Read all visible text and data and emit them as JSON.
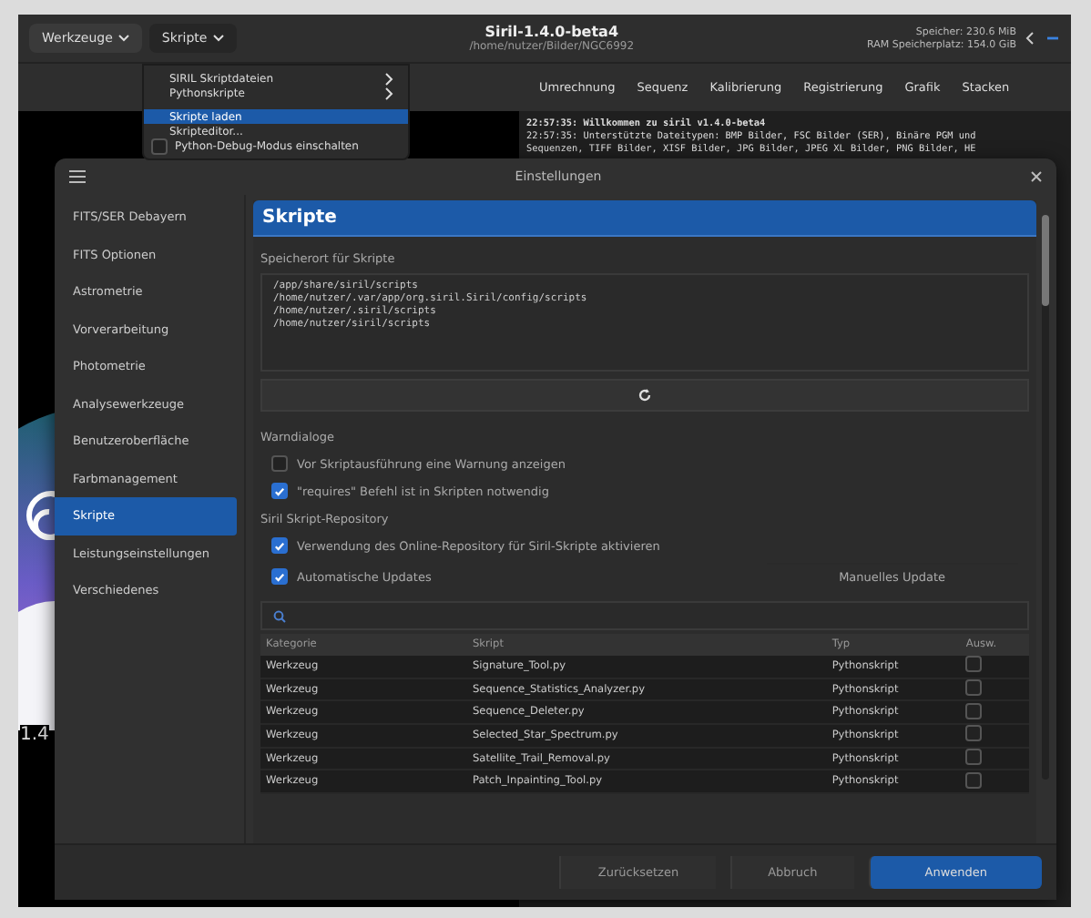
{
  "header": {
    "menus": [
      {
        "label": "Werkzeuge",
        "open": false
      },
      {
        "label": "Skripte",
        "open": true
      }
    ],
    "title": "Siril-1.4.0-beta4",
    "subtitle": "/home/nutzer/Bilder/NGC6992",
    "memory": "Speicher: 230.6 MiB",
    "disk": "RAM Speicherplatz: 154.0 GiB"
  },
  "tabs": [
    "Umrechnung",
    "Sequenz",
    "Kalibrierung",
    "Registrierung",
    "Grafik",
    "Stacken"
  ],
  "log": [
    "22:57:35: Willkommen zu siril v1.4.0-beta4",
    "22:57:35: Unterstützte Dateitypen: BMP Bilder, FSC Bilder (SER), Binäre PGM und",
    "Sequenzen, TIFF Bilder, XISF Bilder, JPG Bilder, JPEG XL Bilder, PNG Bilder, HE"
  ],
  "image": {
    "version_text": "1.4"
  },
  "scripts_menu": {
    "items": [
      {
        "kind": "submenu",
        "label": "SIRIL Skriptdateien",
        "highlighted": false
      },
      {
        "kind": "submenu",
        "label": "Pythonskripte",
        "highlighted": false
      },
      {
        "kind": "separator"
      },
      {
        "kind": "action",
        "label": "Skripte laden",
        "highlighted": true
      },
      {
        "kind": "action",
        "label": "Skripteditor...",
        "highlighted": false
      },
      {
        "kind": "check",
        "label": "Python-Debug-Modus einschalten",
        "checked": false,
        "highlighted": false
      }
    ]
  },
  "dialog": {
    "title": "Einstellungen",
    "sidebar": [
      {
        "label": "FITS/SER Debayern",
        "selected": false
      },
      {
        "label": "FITS Optionen",
        "selected": false
      },
      {
        "label": "Astrometrie",
        "selected": false
      },
      {
        "label": "Vorverarbeitung",
        "selected": false
      },
      {
        "label": "Photometrie",
        "selected": false
      },
      {
        "label": "Analysewerkzeuge",
        "selected": false
      },
      {
        "label": "Benutzeroberfläche",
        "selected": false
      },
      {
        "label": "Farbmanagement",
        "selected": false
      },
      {
        "label": "Skripte",
        "selected": true
      },
      {
        "label": "Leistungseinstellungen",
        "selected": false
      },
      {
        "label": "Verschiedenes",
        "selected": false
      }
    ],
    "heading": "Skripte",
    "paths_label": "Speicherort für Skripte",
    "paths": [
      "/app/share/siril/scripts",
      "/home/nutzer/.var/app/org.siril.Siril/config/scripts",
      "/home/nutzer/.siril/scripts",
      "/home/nutzer/siril/scripts"
    ],
    "warn_title": "Warndialoge",
    "warn_options": [
      {
        "label": "Vor Skriptausführung eine Warnung anzeigen",
        "checked": false
      },
      {
        "label": "\"requires\" Befehl ist in Skripten notwendig",
        "checked": true
      }
    ],
    "repo_title": "Siril Skript-Repository",
    "repo_option": {
      "label": "Verwendung des Online-Repository für Siril-Skripte aktivieren",
      "checked": true
    },
    "auto_update": {
      "label": "Automatische Updates",
      "checked": true
    },
    "manual_update": "Manuelles Update",
    "table": {
      "columns": [
        "Kategorie",
        "Skript",
        "Typ",
        "Ausw."
      ],
      "rows": [
        {
          "category": "Werkzeug",
          "script": "Signature_Tool.py",
          "type": "Pythonskript",
          "checked": false
        },
        {
          "category": "Werkzeug",
          "script": "Sequence_Statistics_Analyzer.py",
          "type": "Pythonskript",
          "checked": false
        },
        {
          "category": "Werkzeug",
          "script": "Sequence_Deleter.py",
          "type": "Pythonskript",
          "checked": false
        },
        {
          "category": "Werkzeug",
          "script": "Selected_Star_Spectrum.py",
          "type": "Pythonskript",
          "checked": false
        },
        {
          "category": "Werkzeug",
          "script": "Satellite_Trail_Removal.py",
          "type": "Pythonskript",
          "checked": false
        },
        {
          "category": "Werkzeug",
          "script": "Patch_Inpainting_Tool.py",
          "type": "Pythonskript",
          "checked": false
        }
      ]
    },
    "buttons": [
      {
        "label": "Zurücksetzen",
        "primary": false
      },
      {
        "label": "Abbruch",
        "primary": false
      },
      {
        "label": "Anwenden",
        "primary": true
      }
    ]
  }
}
